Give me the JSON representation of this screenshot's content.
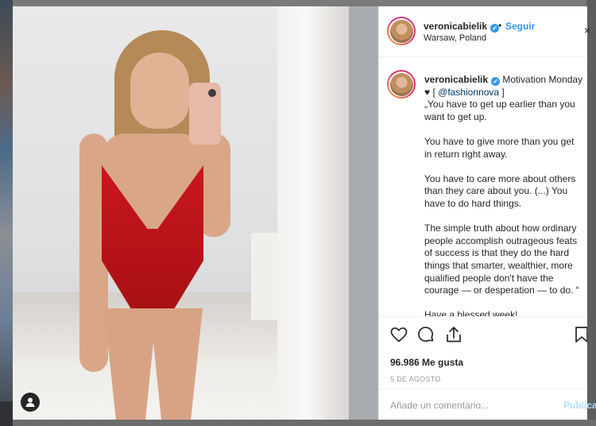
{
  "post": {
    "username": "veronicabielik",
    "verified_mark": "✔",
    "dot": "•",
    "follow_label": "Seguir",
    "location": "Warsaw, Poland",
    "more_label": "×",
    "caption": {
      "username": "veronicabielik",
      "line_first": " Motivation Monday ♥ [ ",
      "mention": "@fashionnova",
      "line_first_end": " ]",
      "p1": "„You have to get up earlier than you want to get up.",
      "p2": "You have to give more than you get in return right away.",
      "p3": "You have to care more about others than they care about you. (...) You have to do hard things.",
      "p4": "The simple truth about how ordinary people accomplish outrageous feats of success is that they do the hard things that smarter, wealthier, more qualified people don't have the courage — or desperation — to do. “",
      "p5": "Have a blessed week!"
    },
    "likes": "96.986 Me gusta",
    "date": "5 DE AGOSTO",
    "comment_placeholder": "Añade un comentario...",
    "publish_label": "Publicar"
  },
  "icons": {
    "like": "heart-icon",
    "comment": "comment-icon",
    "share": "share-icon",
    "save": "bookmark-icon",
    "user_tag": "user-icon"
  },
  "colors": {
    "link": "#3897f0",
    "mention": "#003569",
    "swimsuit": "#c8171d"
  }
}
